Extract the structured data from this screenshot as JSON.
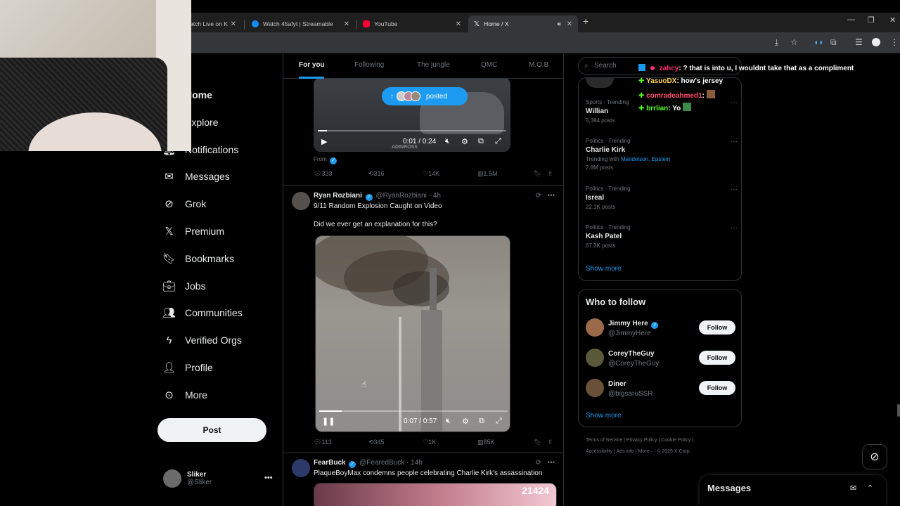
{
  "browser": {
    "tabs": [
      {
        "label": "atch Live on K",
        "color": "#53fc18"
      },
      {
        "label": "Watch 45afyt | Streamable",
        "color": "#0f90fa"
      },
      {
        "label": "YouTube",
        "color": "#ff0033"
      },
      {
        "label": "Home / X",
        "color": "#ffffff"
      }
    ],
    "close_glyph": "✕",
    "new_tab_glyph": "+",
    "win_min": "—",
    "win_max": "❐",
    "win_close": "✕"
  },
  "nav": {
    "items": [
      {
        "label": "Home",
        "icon": "home-icon"
      },
      {
        "label": "Explore",
        "icon": "search-icon"
      },
      {
        "label": "Notifications",
        "icon": "bell-icon"
      },
      {
        "label": "Messages",
        "icon": "envelope-icon"
      },
      {
        "label": "Grok",
        "icon": "grok-icon"
      },
      {
        "label": "Premium",
        "icon": "x-icon"
      },
      {
        "label": "Bookmarks",
        "icon": "bookmark-icon"
      },
      {
        "label": "Jobs",
        "icon": "briefcase-icon"
      },
      {
        "label": "Communities",
        "icon": "people-icon"
      },
      {
        "label": "Verified Orgs",
        "icon": "lightning-icon"
      },
      {
        "label": "Profile",
        "icon": "person-icon"
      },
      {
        "label": "More",
        "icon": "more-circle-icon"
      }
    ],
    "post_label": "Post",
    "account": {
      "name": "Sliker",
      "handle": "@Sliker"
    }
  },
  "timeline": {
    "tabs": [
      "For you",
      "Following",
      "The jungle",
      "QMC",
      "M.O.B"
    ],
    "posted_pill": "posted",
    "tweet1": {
      "source": "From",
      "time": "0:01 / 0:24",
      "watermark": "ADINROSS",
      "replies": "333",
      "reposts": "316",
      "likes": "14K",
      "views": "1.5M"
    },
    "tweet2": {
      "name": "Ryan Rozbiani",
      "handle": "@RyanRozbiani · 4h",
      "line1": "9/11 Random Explosion Caught on Video",
      "line2": "Did we ever get an explanation for this?",
      "time": "0:07 / 0:57",
      "progress": 0.12,
      "replies": "113",
      "reposts": "345",
      "likes": "1K",
      "views": "85K"
    },
    "tweet3": {
      "name": "FearBuck",
      "handle": "@FearedBuck · 14h",
      "text": "PlaqueBoyMax condemns people celebrating Charlie Kirk's assassination",
      "counter": "21424"
    }
  },
  "right": {
    "search_placeholder": "Search",
    "trends": [
      {
        "meta": "Sports · Trending",
        "title": "Willian",
        "count": "5,384 posts"
      },
      {
        "meta": "Politics · Trending",
        "title": "Charlie Kirk",
        "with_label": "Trending with",
        "with_links": "Mandelson, Epstein",
        "count": "2.8M posts"
      },
      {
        "meta": "Politics · Trending",
        "title": "Isreal",
        "count": "22.1K posts"
      },
      {
        "meta": "Politics · Trending",
        "title": "Kash Patel",
        "count": "67.3K posts"
      }
    ],
    "show_more": "Show more",
    "wtf_title": "Who to follow",
    "follow": [
      {
        "name": "Jimmy Here",
        "handle": "@JimmyHere",
        "verified": true
      },
      {
        "name": "CoreyTheGuy",
        "handle": "@CoreyTheGuy",
        "verified": false
      },
      {
        "name": "Diner",
        "handle": "@bigsaruSSR",
        "verified": false
      }
    ],
    "follow_label": "Follow",
    "footer1": "Terms of Service  |  Privacy Policy  |  Cookie Policy  |",
    "footer2": "Accessibility  |  Ads info  |  More ···  © 2025 X Corp."
  },
  "chat": [
    {
      "user": "zahcy",
      "msg": ": ? that is into u, I wouldnt take that as a compliment",
      "color": "#ff2d75"
    },
    {
      "user": "YasuoDX",
      "msg": ": how's jersey",
      "color": "#ffd84a"
    },
    {
      "user": "comradeahmed1",
      "msg": ":",
      "color": "#ff4f6d"
    },
    {
      "user": "brrlian",
      "msg": ": Yo",
      "color": "#53fc18"
    }
  ],
  "messages_drawer": {
    "title": "Messages"
  }
}
